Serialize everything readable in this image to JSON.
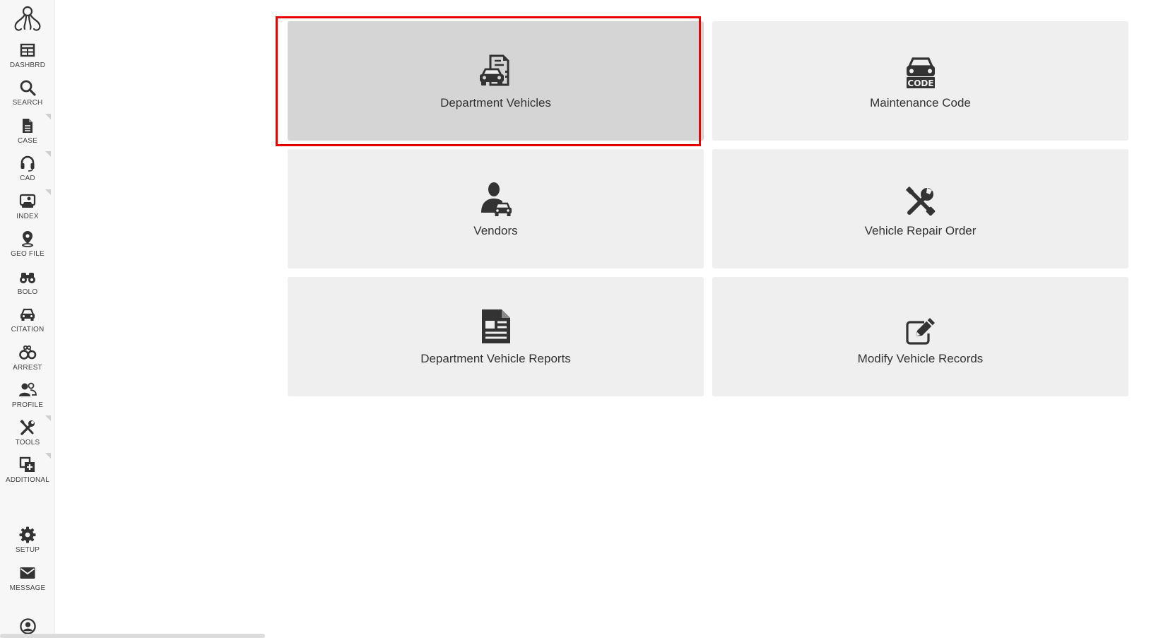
{
  "sidebar": {
    "items": [
      {
        "label": "DASHBRD",
        "icon": "dashboard-grid-icon"
      },
      {
        "label": "SEARCH",
        "icon": "search-icon"
      },
      {
        "label": "CASE",
        "icon": "document-icon"
      },
      {
        "label": "CAD",
        "icon": "headset-icon"
      },
      {
        "label": "INDEX",
        "icon": "vehicle-id-icon"
      },
      {
        "label": "GEO FILE",
        "icon": "map-pin-icon"
      },
      {
        "label": "BOLO",
        "icon": "binoculars-icon"
      },
      {
        "label": "CITATION",
        "icon": "car-icon"
      },
      {
        "label": "ARREST",
        "icon": "handcuffs-icon"
      },
      {
        "label": "PROFILE",
        "icon": "users-icon"
      },
      {
        "label": "TOOLS",
        "icon": "tools-icon"
      },
      {
        "label": "ADDITIONAL",
        "icon": "add-window-icon"
      },
      {
        "label": "SETUP",
        "icon": "gear-icon"
      },
      {
        "label": "MESSAGE",
        "icon": "envelope-icon"
      }
    ]
  },
  "tiles": [
    {
      "label": "Department Vehicles",
      "icon": "vehicle-document-icon",
      "selected": true
    },
    {
      "label": "Maintenance Code",
      "icon": "car-code-icon",
      "selected": false
    },
    {
      "label": "Vendors",
      "icon": "person-car-icon",
      "selected": false
    },
    {
      "label": "Vehicle Repair Order",
      "icon": "wrench-screwdriver-icon",
      "selected": false
    },
    {
      "label": "Department Vehicle Reports",
      "icon": "report-document-icon",
      "selected": false
    },
    {
      "label": "Modify Vehicle Records",
      "icon": "edit-pencil-icon",
      "selected": false
    }
  ],
  "colors": {
    "highlight": "#e60000",
    "tile_bg": "#efefef",
    "tile_selected_bg": "#d5d5d5",
    "icon": "#333333"
  }
}
